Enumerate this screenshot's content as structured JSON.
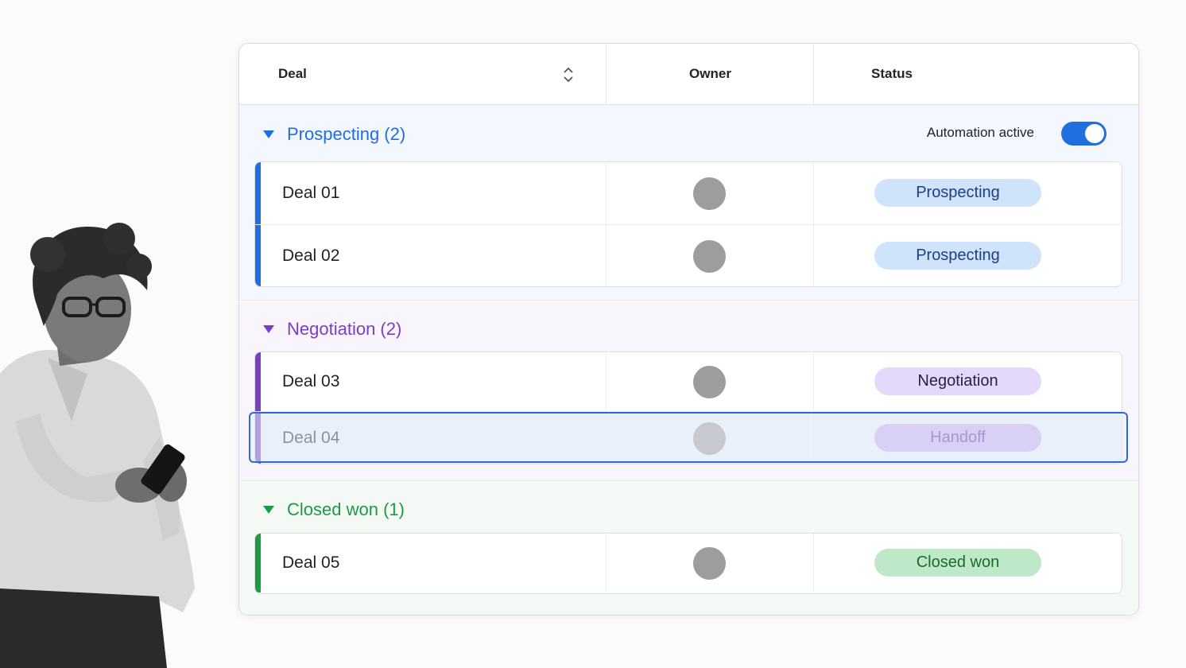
{
  "colors": {
    "prospecting": "#1f6fe0",
    "negotiation": "#7b3fc4",
    "closed_won": "#1c9b43",
    "toggle_on": "#1f6fe0"
  },
  "table": {
    "columns": {
      "deal": "Deal",
      "owner": "Owner",
      "status": "Status"
    },
    "sort_icon": "sort-up-down-icon",
    "groups": [
      {
        "title": "Prospecting (2)",
        "automation_label": "Automation active",
        "automation_on": true,
        "rows": [
          {
            "name": "Deal 01",
            "status": "Prospecting"
          },
          {
            "name": "Deal 02",
            "status": "Prospecting"
          }
        ]
      },
      {
        "title": "Negotiation (2)",
        "rows": [
          {
            "name": "Deal 03",
            "status": "Negotiation"
          },
          {
            "name": "Deal 04",
            "status": "Handoff",
            "selected": true
          }
        ]
      },
      {
        "title": "Closed won (1)",
        "rows": [
          {
            "name": "Deal 05",
            "status": "Closed won"
          }
        ]
      }
    ]
  }
}
